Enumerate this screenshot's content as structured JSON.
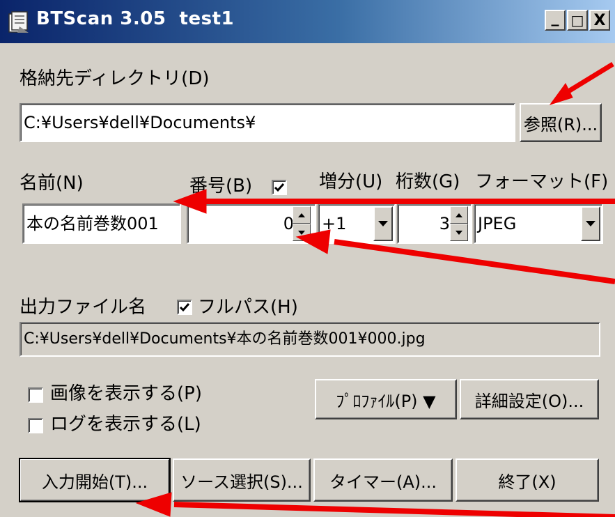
{
  "window": {
    "title": "BTScan 3.05  test1",
    "controls": {
      "minimize": "_",
      "maximize": "□",
      "close": "X"
    }
  },
  "directory": {
    "label": "格納先ディレクトリ(D)",
    "value": "C:¥Users¥dell¥Documents¥",
    "browse_button": "参照(R)..."
  },
  "fields": {
    "name_label": "名前(N)",
    "name_value": "本の名前巻数001",
    "number_label": "番号(B)",
    "number_checked": true,
    "number_value": "0",
    "increment_label": "増分(U)",
    "increment_value": "+1",
    "digits_label": "桁数(G)",
    "digits_value": "3",
    "format_label": "フォーマット(F)",
    "format_value": "JPEG"
  },
  "output": {
    "label": "出力ファイル名",
    "fullpath_label": "フルパス(H)",
    "fullpath_checked": true,
    "value": "C:¥Users¥dell¥Documents¥本の名前巻数001¥000.jpg"
  },
  "options": {
    "show_image_label": "画像を表示する(P)",
    "show_image_checked": false,
    "show_log_label": "ログを表示する(L)",
    "show_log_checked": false,
    "profile_button": "ﾌﾟﾛﾌｧｲﾙ(P) ▼",
    "advanced_button": "詳細設定(O)..."
  },
  "actions": {
    "start_button": "入力開始(T)...",
    "source_button": "ソース選択(S)...",
    "timer_button": "タイマー(A)...",
    "exit_button": "終了(X)"
  },
  "colors": {
    "titlebar_start": "#0a246a",
    "titlebar_end": "#a6caf0",
    "face": "#d4d0c8",
    "annotation_arrow": "#ee0000"
  }
}
